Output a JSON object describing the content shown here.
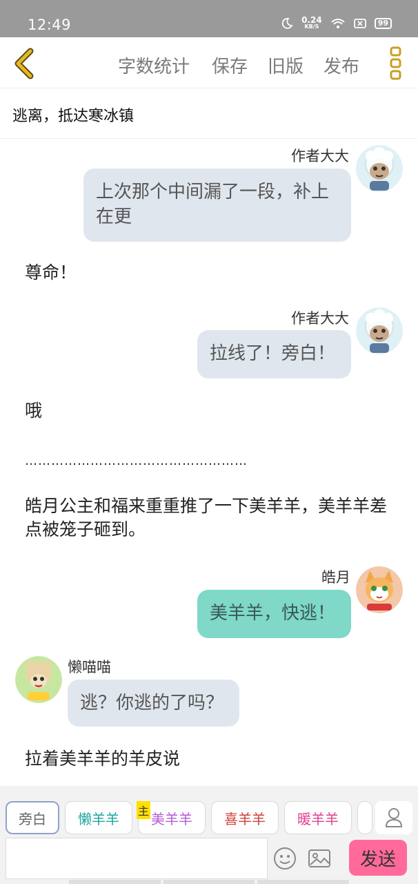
{
  "status_bar": {
    "time": "12:49",
    "net_speed": "0.24",
    "net_unit": "KB/S",
    "battery": "99"
  },
  "toolbar": {
    "word_count": "字数统计",
    "save": "保存",
    "old_version": "旧版",
    "publish": "发布"
  },
  "chapter_title": "逃离，抵达寒冰镇",
  "messages": [
    {
      "speaker": "作者大大",
      "text": "上次那个中间漏了一段，补上在更"
    },
    {
      "narration": "尊命！"
    },
    {
      "speaker": "作者大大",
      "text": "拉线了！旁白！"
    },
    {
      "narration": "哦"
    },
    {
      "narration": "……………………………………………"
    },
    {
      "narration": "皓月公主和福来重重推了一下美羊羊，美羊羊差点被笼子砸到。"
    },
    {
      "speaker": "皓月",
      "text": "美羊羊，快逃！"
    },
    {
      "speaker": "懒喵喵",
      "text": "逃？你逃的了吗？"
    },
    {
      "narration": "拉着美羊羊的羊皮说"
    }
  ],
  "characters": [
    {
      "label": "旁白",
      "color": "#666666"
    },
    {
      "label": "懒羊羊",
      "color": "#1aa7a0"
    },
    {
      "label": "美羊羊",
      "color": "#b55bd6"
    },
    {
      "label": "喜羊羊",
      "color": "#d0403a"
    },
    {
      "label": "暖羊羊",
      "color": "#e23f8f"
    }
  ],
  "main_tag": "主",
  "input": {
    "value": "",
    "placeholder": ""
  },
  "send_label": "发送",
  "colors": {
    "accent_yellow": "#e7b81f",
    "bubble_gray": "#e0e6ee",
    "bubble_teal": "#7fd8c8",
    "send_pink": "#ff6a9a"
  }
}
